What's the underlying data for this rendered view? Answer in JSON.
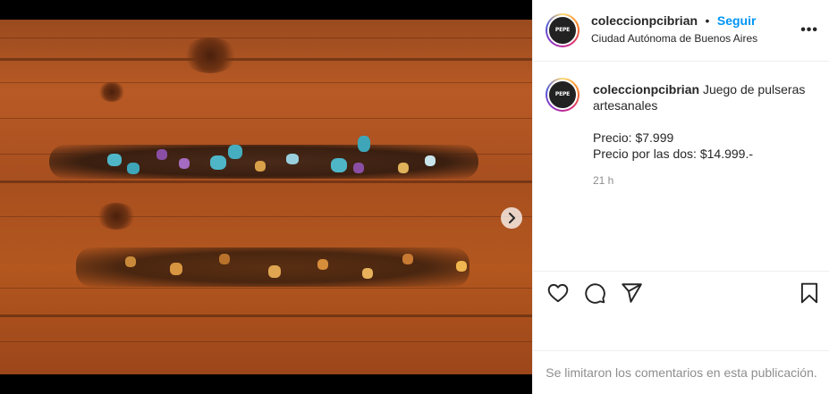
{
  "post": {
    "username": "coleccionpcibrian",
    "follow_label": "Seguir",
    "separator": "•",
    "location": "Ciudad Autónoma de Buenos Aires",
    "more_label": "•••",
    "avatar_text": "PEPE",
    "caption": {
      "text": "Juego de pulseras artesanales",
      "price_line": "Precio: $7.999",
      "pair_price_line": "Precio por las dos: $14.999.-",
      "time": "21 h"
    },
    "carousel": {
      "slide_count": 4,
      "active_index": 0
    },
    "comments_disabled_text": "Se limitaron los comentarios en esta publicación."
  },
  "icons": {
    "like": "heart-icon",
    "comment": "comment-bubble-icon",
    "share": "paper-plane-icon",
    "save": "bookmark-icon",
    "next": "chevron-right-icon",
    "more": "more-options-icon"
  },
  "colors": {
    "follow": "#0095f6",
    "text": "#262626",
    "muted": "#8e8e8e"
  }
}
